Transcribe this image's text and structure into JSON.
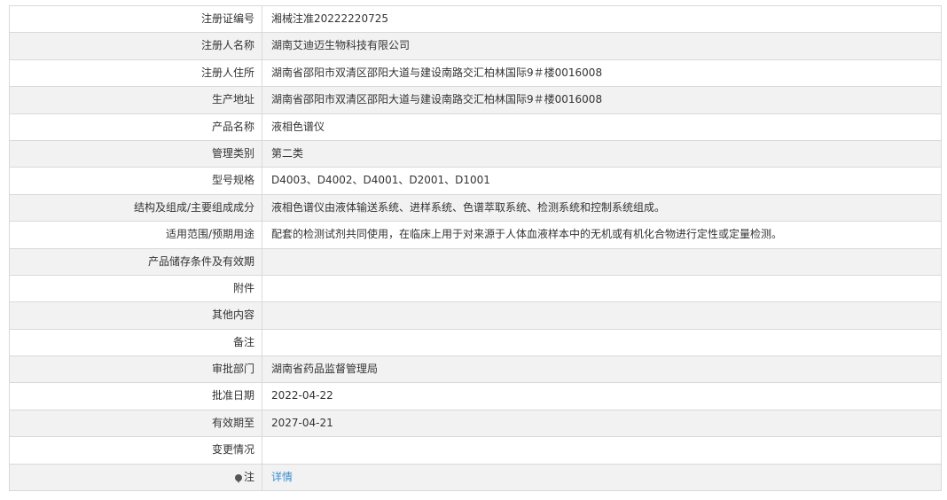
{
  "rows": [
    {
      "label": "注册证编号",
      "value": "湘械注准20222220725"
    },
    {
      "label": "注册人名称",
      "value": "湖南艾迪迈生物科技有限公司"
    },
    {
      "label": "注册人住所",
      "value": "湖南省邵阳市双清区邵阳大道与建设南路交汇柏林国际9＃楼0016008"
    },
    {
      "label": "生产地址",
      "value": "湖南省邵阳市双清区邵阳大道与建设南路交汇柏林国际9＃楼0016008"
    },
    {
      "label": "产品名称",
      "value": "液相色谱仪"
    },
    {
      "label": "管理类别",
      "value": "第二类"
    },
    {
      "label": "型号规格",
      "value": "D4003、D4002、D4001、D2001、D1001"
    },
    {
      "label": "结构及组成/主要组成成分",
      "value": "液相色谱仪由液体输送系统、进样系统、色谱萃取系统、检测系统和控制系统组成。"
    },
    {
      "label": "适用范围/预期用途",
      "value": "配套的检测试剂共同使用，在临床上用于对来源于人体血液样本中的无机或有机化合物进行定性或定量检测。"
    },
    {
      "label": "产品储存条件及有效期",
      "value": ""
    },
    {
      "label": "附件",
      "value": ""
    },
    {
      "label": "其他内容",
      "value": ""
    },
    {
      "label": "备注",
      "value": ""
    },
    {
      "label": "审批部门",
      "value": "湖南省药品监督管理局"
    },
    {
      "label": "批准日期",
      "value": "2022-04-22"
    },
    {
      "label": "有效期至",
      "value": "2027-04-21"
    },
    {
      "label": "变更情况",
      "value": ""
    }
  ],
  "note_row": {
    "label": "注",
    "icon": "map-pin-icon",
    "link_text": "详情"
  }
}
